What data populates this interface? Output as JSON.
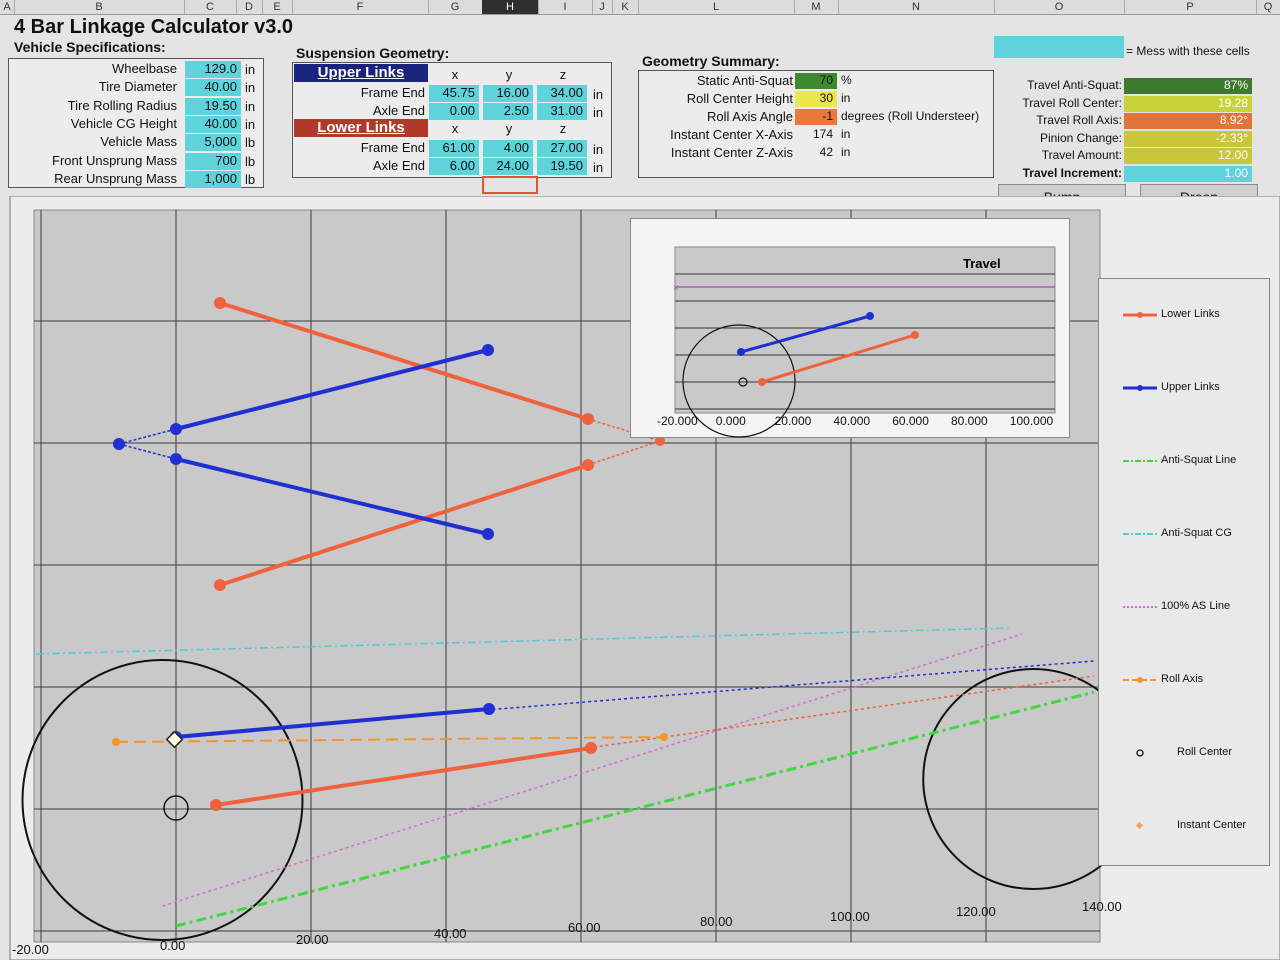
{
  "columns": [
    "A",
    "B",
    "C",
    "D",
    "E",
    "F",
    "G",
    "H",
    "I",
    "J",
    "K",
    "L",
    "M",
    "N",
    "O",
    "P",
    "Q"
  ],
  "app_title": "4 Bar Linkage Calculator v3.0",
  "mess_note": "= Mess with these cells",
  "vehicle": {
    "heading": "Vehicle Specifications:",
    "rows": [
      {
        "label": "Wheelbase",
        "value": "129.0",
        "unit": "in"
      },
      {
        "label": "Tire Diameter",
        "value": "40.00",
        "unit": "in"
      },
      {
        "label": "Tire Rolling Radius",
        "value": "19.50",
        "unit": "in"
      },
      {
        "label": "Vehicle CG Height",
        "value": "40.00",
        "unit": "in"
      },
      {
        "label": "Vehicle Mass",
        "value": "5,000",
        "unit": "lb"
      },
      {
        "label": "Front Unsprung Mass",
        "value": "700",
        "unit": "lb"
      },
      {
        "label": "Rear Unsprung Mass",
        "value": "1,000",
        "unit": "lb"
      }
    ]
  },
  "suspension": {
    "heading": "Suspension Geometry:",
    "axes": [
      "x",
      "y",
      "z"
    ],
    "upper": {
      "title": "Upper Links",
      "frame": {
        "label": "Frame End",
        "x": "45.75",
        "y": "16.00",
        "z": "34.00",
        "unit": "in"
      },
      "axle": {
        "label": "Axle End",
        "x": "0.00",
        "y": "2.50",
        "z": "31.00",
        "unit": "in"
      }
    },
    "lower": {
      "title": "Lower Links",
      "frame": {
        "label": "Frame End",
        "x": "61.00",
        "y": "4.00",
        "z": "27.00",
        "unit": "in"
      },
      "axle": {
        "label": "Axle End",
        "x": "6.00",
        "y": "24.00",
        "z": "19.50",
        "unit": "in"
      }
    }
  },
  "summary": {
    "heading": "Geometry Summary:",
    "rows": [
      {
        "label": "Static Anti-Squat",
        "value": "70",
        "unit": "%",
        "color": "#3f8a2e"
      },
      {
        "label": "Roll Center Height",
        "value": "30",
        "unit": "in",
        "color": "#e8e84a"
      },
      {
        "label": "Roll Axis Angle",
        "value": "-1",
        "unit": "degrees (Roll Understeer)",
        "color": "#e8793a"
      },
      {
        "label": "Instant Center X-Axis",
        "value": "174",
        "unit": "in",
        "color": ""
      },
      {
        "label": "Instant Center Z-Axis",
        "value": "42",
        "unit": "in",
        "color": ""
      }
    ]
  },
  "travel": {
    "rows": [
      {
        "label": "Travel Anti-Squat:",
        "value": "87%",
        "color": "#3c7a2c"
      },
      {
        "label": "Travel Roll Center:",
        "value": "19.28",
        "color": "#c8d33a"
      },
      {
        "label": "Travel Roll Axis:",
        "value": "8.92°",
        "color": "#e0743a"
      },
      {
        "label": "Pinion Change:",
        "value": "-2.33°",
        "color": "#c8c63a"
      },
      {
        "label": "Travel Amount:",
        "value": "12.00",
        "color": "#c8c63a"
      },
      {
        "label": "Travel Increment:",
        "value": "1.00",
        "color": "#5ed3dc"
      }
    ],
    "bump_label": "Bump",
    "droop_label": "Droop"
  },
  "main_chart": {
    "x_ticks": [
      "-20.00",
      "0.00",
      "20.00",
      "40.00",
      "60.00",
      "80.00",
      "100.00",
      "120.00",
      "140.00"
    ]
  },
  "inset_chart": {
    "title": "Travel",
    "x_ticks": [
      "-20.000",
      "0.000",
      "20.000",
      "40.000",
      "60.000",
      "80.000",
      "100.000"
    ]
  },
  "legend": [
    {
      "label": "Lower Links",
      "color": "#f0623c",
      "style": "solid"
    },
    {
      "label": "Upper Links",
      "color": "#1f2fd1",
      "style": "solid"
    },
    {
      "label": "Anti-Squat Line",
      "color": "#3fd83f",
      "style": "dashdot"
    },
    {
      "label": "Anti-Squat CG",
      "color": "#56c9d6",
      "style": "dashdot"
    },
    {
      "label": "100% AS Line",
      "color": "#d86ad8",
      "style": "dotted"
    },
    {
      "label": "Roll Axis",
      "color": "#f0962c",
      "style": "dashed"
    },
    {
      "label": "Roll Center",
      "color": "#111111",
      "style": "marker-circle"
    },
    {
      "label": "Instant Center",
      "color": "#f0a060",
      "style": "marker-diamond"
    }
  ]
}
